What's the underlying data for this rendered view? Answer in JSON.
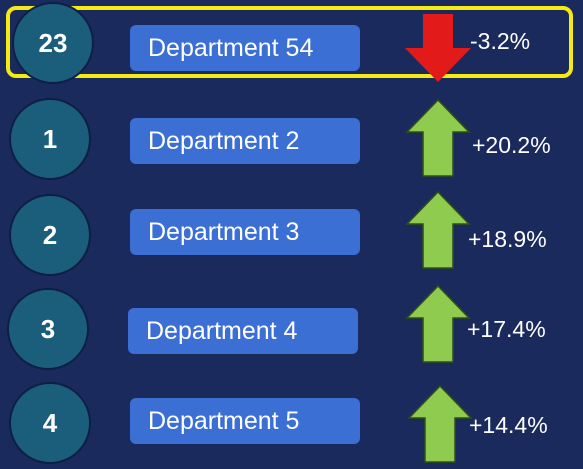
{
  "colors": {
    "background": "#1b2a5c",
    "circle": "#1b5e7c",
    "department_pill": "#3b6fd4",
    "highlight_border": "#f4ea14",
    "arrow_up": "#8ecb4f",
    "arrow_down": "#e31a1a"
  },
  "highlighted": {
    "rank": "23",
    "department": "Department 54",
    "change": "-3.2%",
    "direction_icon": "arrow-down-icon"
  },
  "rows": [
    {
      "rank": "1",
      "department": "Department 2",
      "change": "+20.2%",
      "direction_icon": "arrow-up-icon"
    },
    {
      "rank": "2",
      "department": "Department 3",
      "change": "+18.9%",
      "direction_icon": "arrow-up-icon"
    },
    {
      "rank": "3",
      "department": "Department 4",
      "change": "+17.4%",
      "direction_icon": "arrow-up-icon"
    },
    {
      "rank": "4",
      "department": "Department 5",
      "change": "+14.4%",
      "direction_icon": "arrow-up-icon"
    }
  ]
}
